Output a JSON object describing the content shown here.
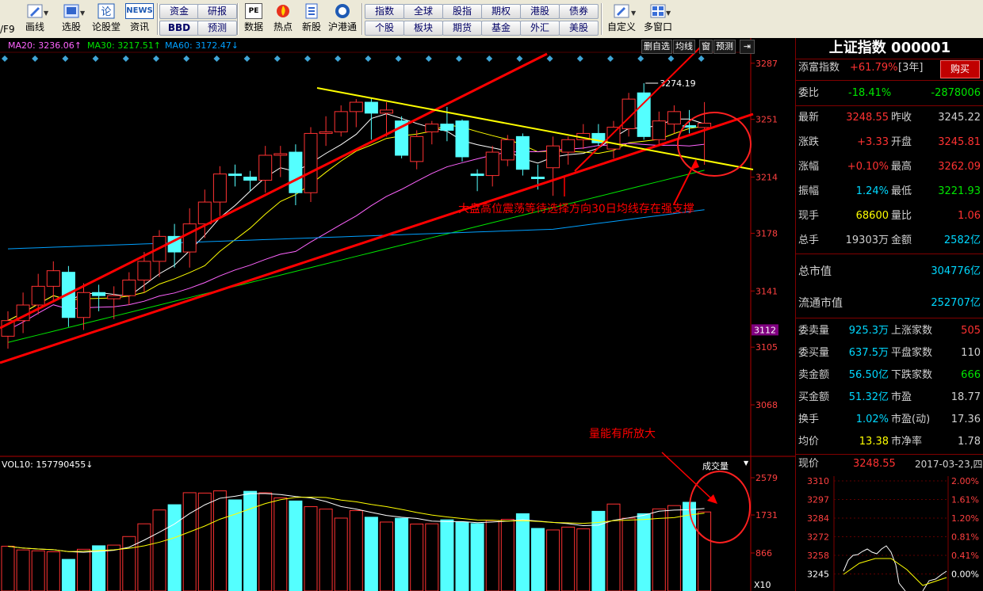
{
  "toolbar": {
    "left_fragment": "/F9",
    "icons": [
      {
        "name": "draw-icon",
        "label": "画线"
      },
      {
        "name": "select-stock-icon",
        "label": "选股"
      },
      {
        "name": "forum-icon",
        "label": "论股堂"
      },
      {
        "name": "news-icon",
        "label": "资讯"
      },
      {
        "name": "data-icon",
        "label": "数据"
      },
      {
        "name": "hot-icon",
        "label": "热点"
      },
      {
        "name": "new-stock-icon",
        "label": "新股"
      },
      {
        "name": "hk-connect-icon",
        "label": "沪港通"
      },
      {
        "name": "custom-icon",
        "label": "自定义"
      },
      {
        "name": "multi-window-icon",
        "label": "多窗口"
      }
    ],
    "news_logo": "NEWS",
    "pe_logo": "PE",
    "group1": {
      "top": [
        "资金",
        "研报"
      ],
      "bottom": [
        "BBD",
        "预测"
      ]
    },
    "group2": {
      "top": [
        "指数",
        "全球",
        "股指",
        "期权",
        "港股",
        "债券"
      ],
      "bottom": [
        "个股",
        "板块",
        "期货",
        "基金",
        "外汇",
        "美股"
      ]
    }
  },
  "chart": {
    "ma20": "MA20: 3236.06↑",
    "ma30": "MA30: 3217.51↑",
    "ma60": "MA60: 3172.47↓",
    "buttons": [
      "删自选",
      "均线",
      "窗",
      "预测"
    ],
    "price_axis": [
      "3287",
      "3251",
      "3214",
      "3178",
      "3141",
      "3105",
      "3068"
    ],
    "current_price_tag": "3112",
    "high_marker": "3274.19",
    "annotation_main": "大盘高位震荡等待选择方向30日均线存在强支撑",
    "annotation_volume": "量能有所放大",
    "vol_label": "VOL10: 157790455↓",
    "vol_select": "成交量",
    "vol_axis": [
      "2579",
      "1731",
      "866"
    ],
    "vol_unit": "X10",
    "colors": {
      "up": "#ff3232",
      "down": "#54ffff",
      "ma5": "#ffffff",
      "ma10": "#ffff00",
      "ma20": "#ff64ff",
      "ma30": "#00e600",
      "ma60": "#00a0ff",
      "annotation": "#ff0000",
      "trend_yellow": "#ffff00"
    }
  },
  "chart_data": {
    "type": "candlestick",
    "candles": [
      {
        "o": 3112,
        "h": 3128,
        "l": 3104,
        "c": 3122
      },
      {
        "o": 3122,
        "h": 3140,
        "l": 3114,
        "c": 3132
      },
      {
        "o": 3132,
        "h": 3152,
        "l": 3126,
        "c": 3144
      },
      {
        "o": 3144,
        "h": 3160,
        "l": 3135,
        "c": 3154
      },
      {
        "o": 3153,
        "h": 3157,
        "l": 3118,
        "c": 3124
      },
      {
        "o": 3124,
        "h": 3146,
        "l": 3116,
        "c": 3140
      },
      {
        "o": 3140,
        "h": 3145,
        "l": 3128,
        "c": 3138
      },
      {
        "o": 3136,
        "h": 3144,
        "l": 3123,
        "c": 3138
      },
      {
        "o": 3138,
        "h": 3153,
        "l": 3132,
        "c": 3148
      },
      {
        "o": 3148,
        "h": 3166,
        "l": 3140,
        "c": 3160
      },
      {
        "o": 3160,
        "h": 3180,
        "l": 3150,
        "c": 3176
      },
      {
        "o": 3176,
        "h": 3184,
        "l": 3156,
        "c": 3166
      },
      {
        "o": 3166,
        "h": 3194,
        "l": 3156,
        "c": 3184
      },
      {
        "o": 3184,
        "h": 3206,
        "l": 3175,
        "c": 3198
      },
      {
        "o": 3198,
        "h": 3221,
        "l": 3189,
        "c": 3216
      },
      {
        "o": 3216,
        "h": 3222,
        "l": 3208,
        "c": 3215
      },
      {
        "o": 3214,
        "h": 3218,
        "l": 3205,
        "c": 3212
      },
      {
        "o": 3212,
        "h": 3234,
        "l": 3204,
        "c": 3228
      },
      {
        "o": 3228,
        "h": 3234,
        "l": 3214,
        "c": 3229
      },
      {
        "o": 3230,
        "h": 3235,
        "l": 3196,
        "c": 3204
      },
      {
        "o": 3204,
        "h": 3246,
        "l": 3198,
        "c": 3242
      },
      {
        "o": 3242,
        "h": 3253,
        "l": 3234,
        "c": 3243
      },
      {
        "o": 3243,
        "h": 3260,
        "l": 3240,
        "c": 3256
      },
      {
        "o": 3256,
        "h": 3264,
        "l": 3246,
        "c": 3262
      },
      {
        "o": 3262,
        "h": 3265,
        "l": 3238,
        "c": 3255
      },
      {
        "o": 3255,
        "h": 3262,
        "l": 3240,
        "c": 3257
      },
      {
        "o": 3250,
        "h": 3253,
        "l": 3226,
        "c": 3228
      },
      {
        "o": 3224,
        "h": 3244,
        "l": 3219,
        "c": 3240
      },
      {
        "o": 3243,
        "h": 3250,
        "l": 3235,
        "c": 3248
      },
      {
        "o": 3248,
        "h": 3259,
        "l": 3237,
        "c": 3244
      },
      {
        "o": 3250,
        "h": 3251,
        "l": 3224,
        "c": 3227
      },
      {
        "o": 3216,
        "h": 3219,
        "l": 3205,
        "c": 3215
      },
      {
        "o": 3215,
        "h": 3234,
        "l": 3208,
        "c": 3230
      },
      {
        "o": 3225,
        "h": 3241,
        "l": 3221,
        "c": 3238
      },
      {
        "o": 3240,
        "h": 3242,
        "l": 3215,
        "c": 3219
      },
      {
        "o": 3214,
        "h": 3222,
        "l": 3206,
        "c": 3213
      },
      {
        "o": 3220,
        "h": 3240,
        "l": 3202,
        "c": 3234
      },
      {
        "o": 3230,
        "h": 3240,
        "l": 3222,
        "c": 3238
      },
      {
        "o": 3238,
        "h": 3248,
        "l": 3232,
        "c": 3242
      },
      {
        "o": 3242,
        "h": 3248,
        "l": 3234,
        "c": 3236
      },
      {
        "o": 3232,
        "h": 3250,
        "l": 3226,
        "c": 3246
      },
      {
        "o": 3245,
        "h": 3268,
        "l": 3240,
        "c": 3264
      },
      {
        "o": 3268,
        "h": 3274.19,
        "l": 3238,
        "c": 3240
      },
      {
        "o": 3238,
        "h": 3256,
        "l": 3234,
        "c": 3250
      },
      {
        "o": 3248,
        "h": 3260,
        "l": 3242,
        "c": 3256
      },
      {
        "o": 3247,
        "h": 3257,
        "l": 3242,
        "c": 3246
      },
      {
        "o": 3245.81,
        "h": 3262.09,
        "l": 3221.93,
        "c": 3248.55
      }
    ],
    "volume": [
      1020,
      935,
      915,
      893,
      720,
      950,
      1030,
      1045,
      1240,
      1530,
      1845,
      1965,
      2238,
      2230,
      2280,
      2075,
      2270,
      2236,
      2120,
      2050,
      1920,
      1865,
      1660,
      1830,
      1680,
      1570,
      1655,
      1525,
      1530,
      1620,
      1570,
      1535,
      1605,
      1632,
      1760,
      1425,
      1390,
      1455,
      1415,
      1815,
      1980,
      1658,
      1760,
      1870,
      1945,
      2020,
      1800
    ],
    "ylim": [
      3035,
      3293
    ],
    "vol_ylim": [
      0,
      2850
    ]
  },
  "panel": {
    "title": "上证指数 000001",
    "tianfu_label": "添富指数",
    "tianfu_value": "+61.79%",
    "tianfu_period": "[3年]",
    "buy_button": "购买",
    "weibi_label": "委比",
    "weibi_value": "-18.41%",
    "weibi_diff": "-2878006",
    "quote_rows": [
      {
        "l1": "最新",
        "v1": "3248.55",
        "l2": "昨收",
        "v2": "3245.22",
        "c1": "red",
        "c2": "white"
      },
      {
        "l1": "涨跌",
        "v1": "+3.33",
        "l2": "开盘",
        "v2": "3245.81",
        "c1": "red",
        "c2": "red"
      },
      {
        "l1": "涨幅",
        "v1": "+0.10%",
        "l2": "最高",
        "v2": "3262.09",
        "c1": "red",
        "c2": "red"
      },
      {
        "l1": "振幅",
        "v1": "1.24%",
        "l2": "最低",
        "v2": "3221.93",
        "c1": "cyan",
        "c2": "green"
      },
      {
        "l1": "现手",
        "v1": "68600",
        "l2": "量比",
        "v2": "1.06",
        "c1": "yellow",
        "c2": "red"
      },
      {
        "l1": "总手",
        "v1": "19303万",
        "l2": "金额",
        "v2": "2582亿",
        "c1": "white",
        "c2": "cyan"
      }
    ],
    "total_mv_label": "总市值",
    "total_mv_value": "304776亿",
    "float_mv_label": "流通市值",
    "float_mv_value": "252707亿",
    "order_rows": [
      {
        "l1": "委卖量",
        "v1": "925.3万",
        "l2": "上涨家数",
        "v2": "505",
        "c1": "cyan",
        "c2": "red"
      },
      {
        "l1": "委买量",
        "v1": "637.5万",
        "l2": "平盘家数",
        "v2": "110",
        "c1": "cyan",
        "c2": "white"
      },
      {
        "l1": "卖金额",
        "v1": "56.50亿",
        "l2": "下跌家数",
        "v2": "666",
        "c1": "cyan",
        "c2": "green"
      },
      {
        "l1": "买金额",
        "v1": "51.32亿",
        "l2": "市盈",
        "v2": "18.77",
        "c1": "cyan",
        "c2": "white"
      },
      {
        "l1": "换手",
        "v1": "1.02%",
        "l2": "市盈(动)",
        "v2": "17.36",
        "c1": "cyan",
        "c2": "white"
      },
      {
        "l1": "均价",
        "v1": "13.38",
        "l2": "市净率",
        "v2": "1.78",
        "c1": "yellow",
        "c2": "white"
      }
    ],
    "mini_header": {
      "label": "现价",
      "price": "3248.55",
      "date": "2017-03-23,四"
    },
    "mini_left_axis": [
      "3310",
      "3297",
      "3284",
      "3272",
      "3258",
      "3245"
    ],
    "mini_right_axis": [
      "2.00%",
      "1.61%",
      "1.20%",
      "0.81%",
      "0.41%",
      "0.00%"
    ]
  }
}
